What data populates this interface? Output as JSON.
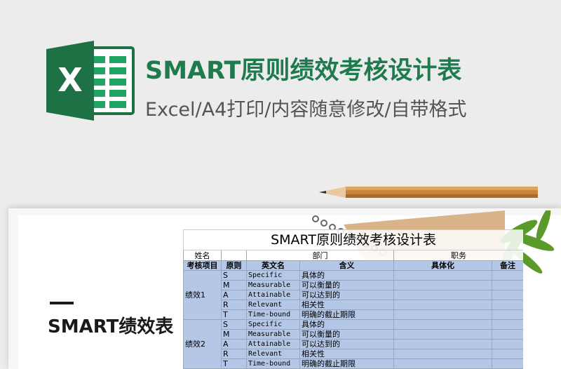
{
  "header": {
    "title": "SMART原则绩效考核设计表",
    "subtitle": "Excel/A4打印/内容随意修改/自带格式"
  },
  "logo": {
    "letter": "X",
    "icon": "excel-logo-icon"
  },
  "preview": {
    "left_title": "SMART绩效表"
  },
  "sheet": {
    "title": "SMART原则绩效考核设计表",
    "info_labels": [
      "姓名",
      "部门",
      "职务"
    ],
    "columns": [
      "考核项目",
      "原则",
      "英文名",
      "含义",
      "具体化",
      "备注"
    ],
    "groups": [
      {
        "name": "绩效1",
        "rows": [
          {
            "letter": "S",
            "english": "Specific",
            "meaning": "具体的"
          },
          {
            "letter": "M",
            "english": "Measurable",
            "meaning": "可以衡量的"
          },
          {
            "letter": "A",
            "english": "Attainable",
            "meaning": "可以达到的"
          },
          {
            "letter": "R",
            "english": "Relevant",
            "meaning": "相关性"
          },
          {
            "letter": "T",
            "english": "Time-bound",
            "meaning": "明确的截止期限"
          }
        ]
      },
      {
        "name": "绩效2",
        "rows": [
          {
            "letter": "S",
            "english": "Specific",
            "meaning": "具体的"
          },
          {
            "letter": "M",
            "english": "Measurable",
            "meaning": "可以衡量的"
          },
          {
            "letter": "A",
            "english": "Attainable",
            "meaning": "可以达到的"
          },
          {
            "letter": "R",
            "english": "Relevant",
            "meaning": "相关性"
          },
          {
            "letter": "T",
            "english": "Time-bound",
            "meaning": "明确的截止期限"
          }
        ]
      }
    ]
  },
  "colors": {
    "brand_green": "#1f7a4d",
    "header_blue": "#b5c7e6"
  }
}
